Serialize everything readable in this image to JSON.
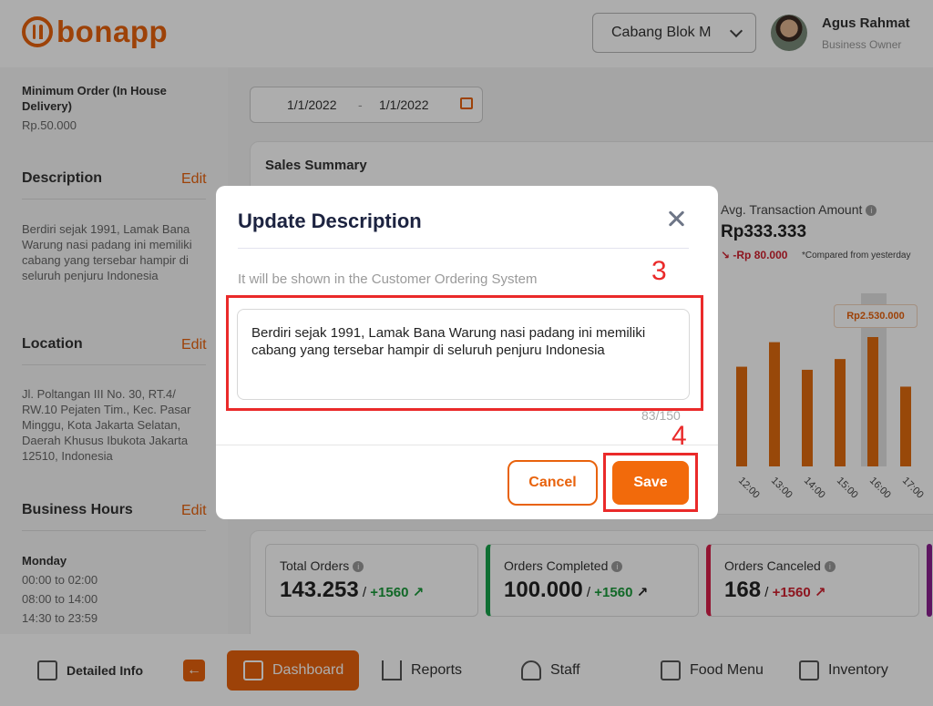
{
  "header": {
    "logo_text": "bonapp",
    "branch": "Cabang Blok M",
    "user_name": "Agus Rahmat",
    "user_role": "Business Owner"
  },
  "left_panel": {
    "min_order_label": "Minimum Order (In House Delivery)",
    "min_order_value": "Rp.50.000",
    "description_heading": "Description",
    "description_text": "Berdiri sejak 1991, Lamak Bana Warung nasi padang ini memiliki cabang yang tersebar hampir di seluruh penjuru Indonesia",
    "location_heading": "Location",
    "location_text": "Jl. Poltangan III No. 30, RT.4/ RW.10 Pejaten Tim., Kec. Pasar Minggu, Kota Jakarta Selatan, Daerah Khusus Ibukota Jakarta 12510, Indonesia",
    "hours_heading": "Business Hours",
    "edit_label": "Edit",
    "hours_day": "Monday",
    "hours": [
      "00:00 to 02:00",
      "08:00 to 14:00",
      "14:30 to 23:59"
    ]
  },
  "date_range": {
    "from": "1/1/2022",
    "separator": "-",
    "to": "1/1/2022"
  },
  "sales_summary": {
    "title": "Sales Summary",
    "avg_label": "Avg. Transaction Amount",
    "avg_value": "Rp333.333",
    "avg_delta": "-Rp 80.000",
    "avg_note": "*Compared from yesterday",
    "peak_label": "Rp2.530.000"
  },
  "chart_data": {
    "type": "bar",
    "categories": [
      "12:00",
      "13:00",
      "14:00",
      "15:00",
      "16:00",
      "17:00"
    ],
    "values": [
      1950000,
      2430000,
      1890000,
      2100000,
      2530000,
      1560000
    ],
    "highlight": "16:00",
    "color": "#e06a0e"
  },
  "orders": [
    {
      "label": "Total Orders",
      "value": "143.253",
      "delta": "+1560",
      "accent": "#e6e6e6",
      "delta_color": "#1a9a3a"
    },
    {
      "label": "Orders Completed",
      "value": "100.000",
      "delta": "+1560",
      "accent": "#17a34a",
      "delta_color": "#1a9a3a"
    },
    {
      "label": "Orders Canceled",
      "value": "168",
      "delta": "+1560",
      "accent": "#d81f4a",
      "delta_color": "#d0202e"
    }
  ],
  "bottom_nav": {
    "detailed_info": "Detailed Info",
    "dashboard": "Dashboard",
    "reports": "Reports",
    "staff": "Staff",
    "food_menu": "Food Menu",
    "inventory": "Inventory"
  },
  "modal": {
    "title": "Update Description",
    "hint": "It will be shown in the Customer Ordering System",
    "description_value": "Berdiri sejak 1991, Lamak Bana Warung nasi padang ini memiliki cabang yang tersebar hampir di seluruh penjuru Indonesia",
    "char_count": "83/150",
    "cancel_label": "Cancel",
    "save_label": "Save"
  },
  "annotations": {
    "step_3": "3",
    "step_4": "4"
  }
}
